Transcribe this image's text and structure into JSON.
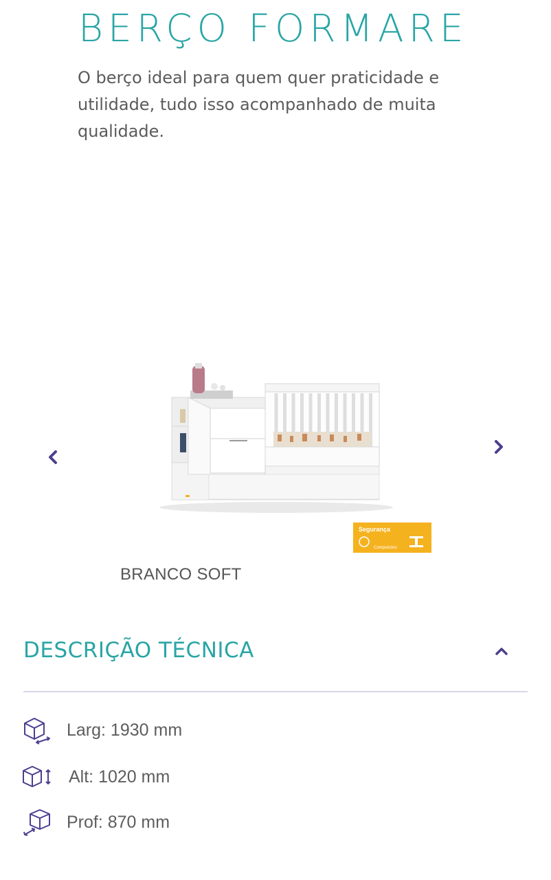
{
  "product": {
    "title": "BERÇO FORMARE",
    "description": "O berço ideal para quem quer praticidade e utilidade, tudo isso acompanhado de muita qualidade."
  },
  "gallery": {
    "prev_icon": "chevron-left-icon",
    "next_icon": "chevron-right-icon",
    "badge": {
      "line1": "Segurança",
      "line2": "Compulsório"
    },
    "color_label": "BRANCO SOFT"
  },
  "technical": {
    "title": "DESCRIÇÃO TÉCNICA",
    "toggle_icon": "chevron-up-icon",
    "specs": [
      {
        "icon": "box-width-icon",
        "text": "Larg: 1930 mm"
      },
      {
        "icon": "box-height-icon",
        "text": "Alt: 1020 mm"
      },
      {
        "icon": "box-depth-icon",
        "text": "Prof: 870 mm"
      }
    ]
  },
  "colors": {
    "accent": "#2aa5a5",
    "arrow": "#4b3f8f",
    "badge": "#f5b21f"
  }
}
